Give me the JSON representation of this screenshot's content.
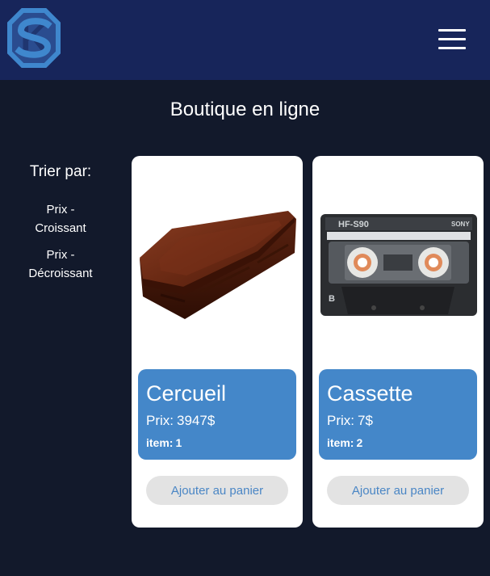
{
  "header": {
    "logo_icon": "s-hexagon-logo-icon",
    "menu_icon": "hamburger-menu-icon",
    "colors": {
      "background": "#17255a",
      "logo": "#3f87cd"
    }
  },
  "page": {
    "title": "Boutique en ligne",
    "background": "#12192b"
  },
  "sort": {
    "title": "Trier par:",
    "options": [
      {
        "line1": "Prix -",
        "line2": "Croissant"
      },
      {
        "line1": "Prix -",
        "line2": "Décroissant"
      }
    ]
  },
  "products": [
    {
      "name": "Cercueil",
      "price_label": "Prix:",
      "price": "3947$",
      "item_label": "item:",
      "item": "1",
      "image_icon": "coffin-image",
      "button_label": "Ajouter au panier"
    },
    {
      "name": "Cassette",
      "price_label": "Prix:",
      "price": "7$",
      "item_label": "item:",
      "item": "2",
      "image_icon": "cassette-tape-image",
      "cassette_brand": "HF-S90",
      "cassette_maker": "SONY",
      "cassette_side": "B",
      "button_label": "Ajouter au panier"
    }
  ],
  "colors": {
    "info_panel": "#4487c9",
    "button_bg": "#e3e3e3",
    "button_text": "#4a86c5"
  }
}
